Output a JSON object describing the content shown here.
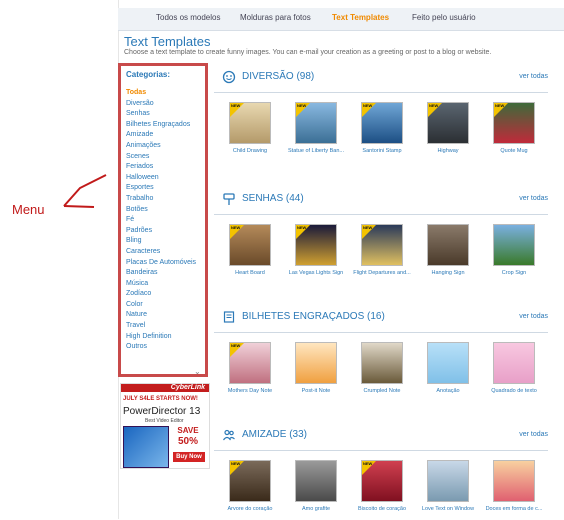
{
  "top_nav": {
    "tabs": [
      {
        "label": "Todos os modelos"
      },
      {
        "label": "Molduras para fotos"
      },
      {
        "label": "Text Templates"
      },
      {
        "label": "Feito pelo usuário"
      }
    ]
  },
  "page": {
    "title": "Text Templates",
    "subtitle": "Choose a text template to create funny images. You can e-mail your creation as a greeting or post to a blog or website."
  },
  "sidebar": {
    "heading": "Categorias:",
    "items": [
      {
        "label": "Todas"
      },
      {
        "label": "Diversão"
      },
      {
        "label": "Senhas"
      },
      {
        "label": "Bilhetes Engraçados"
      },
      {
        "label": "Amizade"
      },
      {
        "label": "Animações"
      },
      {
        "label": "Scenes"
      },
      {
        "label": "Feriados"
      },
      {
        "label": "Halloween"
      },
      {
        "label": "Esportes"
      },
      {
        "label": "Trabalho"
      },
      {
        "label": "Botões"
      },
      {
        "label": "Fé"
      },
      {
        "label": "Padrões"
      },
      {
        "label": "Bling"
      },
      {
        "label": "Caracteres"
      },
      {
        "label": "Placas De Automóveis"
      },
      {
        "label": "Bandeiras"
      },
      {
        "label": "Música"
      },
      {
        "label": "Zodíaco"
      },
      {
        "label": "Color"
      },
      {
        "label": "Nature"
      },
      {
        "label": "Travel"
      },
      {
        "label": "High Definition"
      },
      {
        "label": "Outros"
      }
    ]
  },
  "annotation": {
    "label": "Menu"
  },
  "ad": {
    "brand": "CyberLink",
    "promo": "JULY S4LE STARTS NOW!",
    "product": "PowerDirector 13",
    "edition": "Best Video Editor",
    "save": "SAVE",
    "percent": "50%",
    "buy": "Buy Now"
  },
  "sections": [
    {
      "title": "DIVERSÃO (98)",
      "see_all": "ver todas",
      "icon": "smiley-icon",
      "items": [
        {
          "caption": "Child Drawing",
          "badge": "NEW"
        },
        {
          "caption": "Statue of Liberty Ban...",
          "badge": "NEW"
        },
        {
          "caption": "Santorini Stamp",
          "badge": "NEW"
        },
        {
          "caption": "Highway",
          "badge": "NEW"
        },
        {
          "caption": "Quote Mug",
          "badge": "NEW"
        }
      ]
    },
    {
      "title": "SENHAS (44)",
      "see_all": "ver todas",
      "icon": "sign-icon",
      "items": [
        {
          "caption": "Heart Board",
          "badge": "NEW"
        },
        {
          "caption": "Las Vegas Lights Sign",
          "badge": "NEW"
        },
        {
          "caption": "Flight Departures and...",
          "badge": "NEW"
        },
        {
          "caption": "Hanging Sign",
          "badge": ""
        },
        {
          "caption": "Crop Sign",
          "badge": ""
        }
      ]
    },
    {
      "title": "BILHETES ENGRAÇADOS (16)",
      "see_all": "ver todas",
      "icon": "note-icon",
      "items": [
        {
          "caption": "Mothers Day Note",
          "badge": "NEW"
        },
        {
          "caption": "Post-it Note",
          "badge": ""
        },
        {
          "caption": "Crumpled Note",
          "badge": ""
        },
        {
          "caption": "Anotação",
          "badge": ""
        },
        {
          "caption": "Quadrado de texto",
          "badge": ""
        }
      ]
    },
    {
      "title": "AMIZADE (33)",
      "see_all": "ver todas",
      "icon": "friends-icon",
      "items": [
        {
          "caption": "Árvore do coração",
          "badge": "NEW"
        },
        {
          "caption": "Amo grafite",
          "badge": ""
        },
        {
          "caption": "Biscoito de coração",
          "badge": "NEW"
        },
        {
          "caption": "Love Text on Window",
          "badge": ""
        },
        {
          "caption": "Doces em forma de c...",
          "badge": ""
        }
      ]
    }
  ]
}
